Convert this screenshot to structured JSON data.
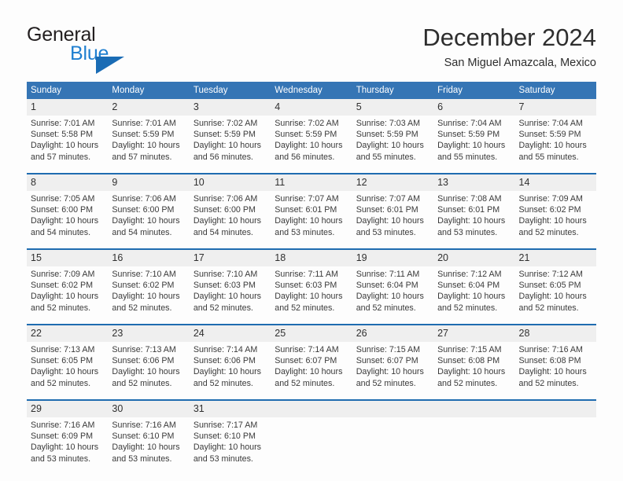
{
  "brand": {
    "name_part1": "General",
    "name_part2": "Blue",
    "mark_icon": "triangle-logo-icon"
  },
  "header": {
    "title": "December 2024",
    "subtitle": "San Miguel Amazcala, Mexico"
  },
  "colors": {
    "header_blue": "#3575b5",
    "separator_blue": "#1f6cb0",
    "daynum_band": "#efefef",
    "brand_blue": "#1f7fd0",
    "text": "#3a3a3a"
  },
  "weekdays": [
    "Sunday",
    "Monday",
    "Tuesday",
    "Wednesday",
    "Thursday",
    "Friday",
    "Saturday"
  ],
  "labels": {
    "sunrise": "Sunrise:",
    "sunset": "Sunset:",
    "daylight": "Daylight:"
  },
  "weeks": [
    {
      "days": [
        {
          "num": "1",
          "sunrise": "Sunrise: 7:01 AM",
          "sunset": "Sunset: 5:58 PM",
          "daylight1": "Daylight: 10 hours",
          "daylight2": "and 57 minutes."
        },
        {
          "num": "2",
          "sunrise": "Sunrise: 7:01 AM",
          "sunset": "Sunset: 5:59 PM",
          "daylight1": "Daylight: 10 hours",
          "daylight2": "and 57 minutes."
        },
        {
          "num": "3",
          "sunrise": "Sunrise: 7:02 AM",
          "sunset": "Sunset: 5:59 PM",
          "daylight1": "Daylight: 10 hours",
          "daylight2": "and 56 minutes."
        },
        {
          "num": "4",
          "sunrise": "Sunrise: 7:02 AM",
          "sunset": "Sunset: 5:59 PM",
          "daylight1": "Daylight: 10 hours",
          "daylight2": "and 56 minutes."
        },
        {
          "num": "5",
          "sunrise": "Sunrise: 7:03 AM",
          "sunset": "Sunset: 5:59 PM",
          "daylight1": "Daylight: 10 hours",
          "daylight2": "and 55 minutes."
        },
        {
          "num": "6",
          "sunrise": "Sunrise: 7:04 AM",
          "sunset": "Sunset: 5:59 PM",
          "daylight1": "Daylight: 10 hours",
          "daylight2": "and 55 minutes."
        },
        {
          "num": "7",
          "sunrise": "Sunrise: 7:04 AM",
          "sunset": "Sunset: 5:59 PM",
          "daylight1": "Daylight: 10 hours",
          "daylight2": "and 55 minutes."
        }
      ]
    },
    {
      "days": [
        {
          "num": "8",
          "sunrise": "Sunrise: 7:05 AM",
          "sunset": "Sunset: 6:00 PM",
          "daylight1": "Daylight: 10 hours",
          "daylight2": "and 54 minutes."
        },
        {
          "num": "9",
          "sunrise": "Sunrise: 7:06 AM",
          "sunset": "Sunset: 6:00 PM",
          "daylight1": "Daylight: 10 hours",
          "daylight2": "and 54 minutes."
        },
        {
          "num": "10",
          "sunrise": "Sunrise: 7:06 AM",
          "sunset": "Sunset: 6:00 PM",
          "daylight1": "Daylight: 10 hours",
          "daylight2": "and 54 minutes."
        },
        {
          "num": "11",
          "sunrise": "Sunrise: 7:07 AM",
          "sunset": "Sunset: 6:01 PM",
          "daylight1": "Daylight: 10 hours",
          "daylight2": "and 53 minutes."
        },
        {
          "num": "12",
          "sunrise": "Sunrise: 7:07 AM",
          "sunset": "Sunset: 6:01 PM",
          "daylight1": "Daylight: 10 hours",
          "daylight2": "and 53 minutes."
        },
        {
          "num": "13",
          "sunrise": "Sunrise: 7:08 AM",
          "sunset": "Sunset: 6:01 PM",
          "daylight1": "Daylight: 10 hours",
          "daylight2": "and 53 minutes."
        },
        {
          "num": "14",
          "sunrise": "Sunrise: 7:09 AM",
          "sunset": "Sunset: 6:02 PM",
          "daylight1": "Daylight: 10 hours",
          "daylight2": "and 52 minutes."
        }
      ]
    },
    {
      "days": [
        {
          "num": "15",
          "sunrise": "Sunrise: 7:09 AM",
          "sunset": "Sunset: 6:02 PM",
          "daylight1": "Daylight: 10 hours",
          "daylight2": "and 52 minutes."
        },
        {
          "num": "16",
          "sunrise": "Sunrise: 7:10 AM",
          "sunset": "Sunset: 6:02 PM",
          "daylight1": "Daylight: 10 hours",
          "daylight2": "and 52 minutes."
        },
        {
          "num": "17",
          "sunrise": "Sunrise: 7:10 AM",
          "sunset": "Sunset: 6:03 PM",
          "daylight1": "Daylight: 10 hours",
          "daylight2": "and 52 minutes."
        },
        {
          "num": "18",
          "sunrise": "Sunrise: 7:11 AM",
          "sunset": "Sunset: 6:03 PM",
          "daylight1": "Daylight: 10 hours",
          "daylight2": "and 52 minutes."
        },
        {
          "num": "19",
          "sunrise": "Sunrise: 7:11 AM",
          "sunset": "Sunset: 6:04 PM",
          "daylight1": "Daylight: 10 hours",
          "daylight2": "and 52 minutes."
        },
        {
          "num": "20",
          "sunrise": "Sunrise: 7:12 AM",
          "sunset": "Sunset: 6:04 PM",
          "daylight1": "Daylight: 10 hours",
          "daylight2": "and 52 minutes."
        },
        {
          "num": "21",
          "sunrise": "Sunrise: 7:12 AM",
          "sunset": "Sunset: 6:05 PM",
          "daylight1": "Daylight: 10 hours",
          "daylight2": "and 52 minutes."
        }
      ]
    },
    {
      "days": [
        {
          "num": "22",
          "sunrise": "Sunrise: 7:13 AM",
          "sunset": "Sunset: 6:05 PM",
          "daylight1": "Daylight: 10 hours",
          "daylight2": "and 52 minutes."
        },
        {
          "num": "23",
          "sunrise": "Sunrise: 7:13 AM",
          "sunset": "Sunset: 6:06 PM",
          "daylight1": "Daylight: 10 hours",
          "daylight2": "and 52 minutes."
        },
        {
          "num": "24",
          "sunrise": "Sunrise: 7:14 AM",
          "sunset": "Sunset: 6:06 PM",
          "daylight1": "Daylight: 10 hours",
          "daylight2": "and 52 minutes."
        },
        {
          "num": "25",
          "sunrise": "Sunrise: 7:14 AM",
          "sunset": "Sunset: 6:07 PM",
          "daylight1": "Daylight: 10 hours",
          "daylight2": "and 52 minutes."
        },
        {
          "num": "26",
          "sunrise": "Sunrise: 7:15 AM",
          "sunset": "Sunset: 6:07 PM",
          "daylight1": "Daylight: 10 hours",
          "daylight2": "and 52 minutes."
        },
        {
          "num": "27",
          "sunrise": "Sunrise: 7:15 AM",
          "sunset": "Sunset: 6:08 PM",
          "daylight1": "Daylight: 10 hours",
          "daylight2": "and 52 minutes."
        },
        {
          "num": "28",
          "sunrise": "Sunrise: 7:16 AM",
          "sunset": "Sunset: 6:08 PM",
          "daylight1": "Daylight: 10 hours",
          "daylight2": "and 52 minutes."
        }
      ]
    },
    {
      "days": [
        {
          "num": "29",
          "sunrise": "Sunrise: 7:16 AM",
          "sunset": "Sunset: 6:09 PM",
          "daylight1": "Daylight: 10 hours",
          "daylight2": "and 53 minutes."
        },
        {
          "num": "30",
          "sunrise": "Sunrise: 7:16 AM",
          "sunset": "Sunset: 6:10 PM",
          "daylight1": "Daylight: 10 hours",
          "daylight2": "and 53 minutes."
        },
        {
          "num": "31",
          "sunrise": "Sunrise: 7:17 AM",
          "sunset": "Sunset: 6:10 PM",
          "daylight1": "Daylight: 10 hours",
          "daylight2": "and 53 minutes."
        },
        {
          "num": "",
          "sunrise": "",
          "sunset": "",
          "daylight1": "",
          "daylight2": ""
        },
        {
          "num": "",
          "sunrise": "",
          "sunset": "",
          "daylight1": "",
          "daylight2": ""
        },
        {
          "num": "",
          "sunrise": "",
          "sunset": "",
          "daylight1": "",
          "daylight2": ""
        },
        {
          "num": "",
          "sunrise": "",
          "sunset": "",
          "daylight1": "",
          "daylight2": ""
        }
      ]
    }
  ]
}
